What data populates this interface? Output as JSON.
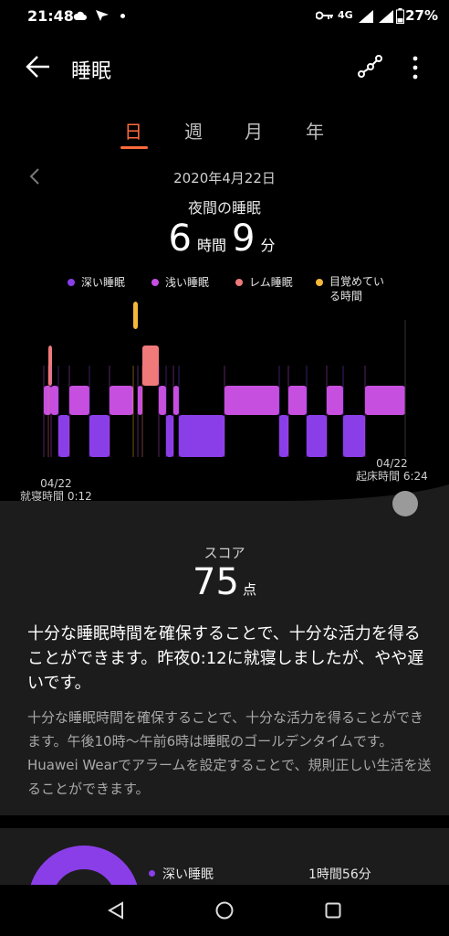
{
  "status_bar": {
    "time": "21:48",
    "battery": "27%",
    "network": "4G"
  },
  "app_bar": {
    "title": "睡眠"
  },
  "tabs": [
    "日",
    "週",
    "月",
    "年"
  ],
  "active_tab": 0,
  "date": "2020年4月22日",
  "subtitle": "夜間の睡眠",
  "duration": {
    "hours": "6",
    "hours_unit": "時間",
    "minutes": "9",
    "minutes_unit": "分"
  },
  "legend": [
    {
      "label": "深い睡眠",
      "color": "#8a3ee8"
    },
    {
      "label": "浅い睡眠",
      "color": "#c64fe0"
    },
    {
      "label": "レム睡眠",
      "color": "#f07a7a"
    },
    {
      "label": "目覚めている時間",
      "color": "#f5b83a"
    }
  ],
  "sleep_start": {
    "date": "04/22",
    "label": "就寝時間 0:12"
  },
  "sleep_end": {
    "date": "04/22",
    "label": "起床時間 6:24"
  },
  "score": {
    "label": "スコア",
    "value": "75",
    "unit": "点"
  },
  "advice_main": "十分な睡眠時間を確保することで、十分な活力を得ることができます。昨夜0:12に就寝しましたが、やや遅いです。",
  "advice_sub": "十分な睡眠時間を確保することで、十分な活力を得ることができます。午後10時〜午前6時は睡眠のゴールデンタイムです。Huawei Wearでアラームを設定することで、規則正しい生活を送ることができます。",
  "summary": {
    "deep_label": "深い睡眠",
    "deep_value": "1時間56分"
  }
}
